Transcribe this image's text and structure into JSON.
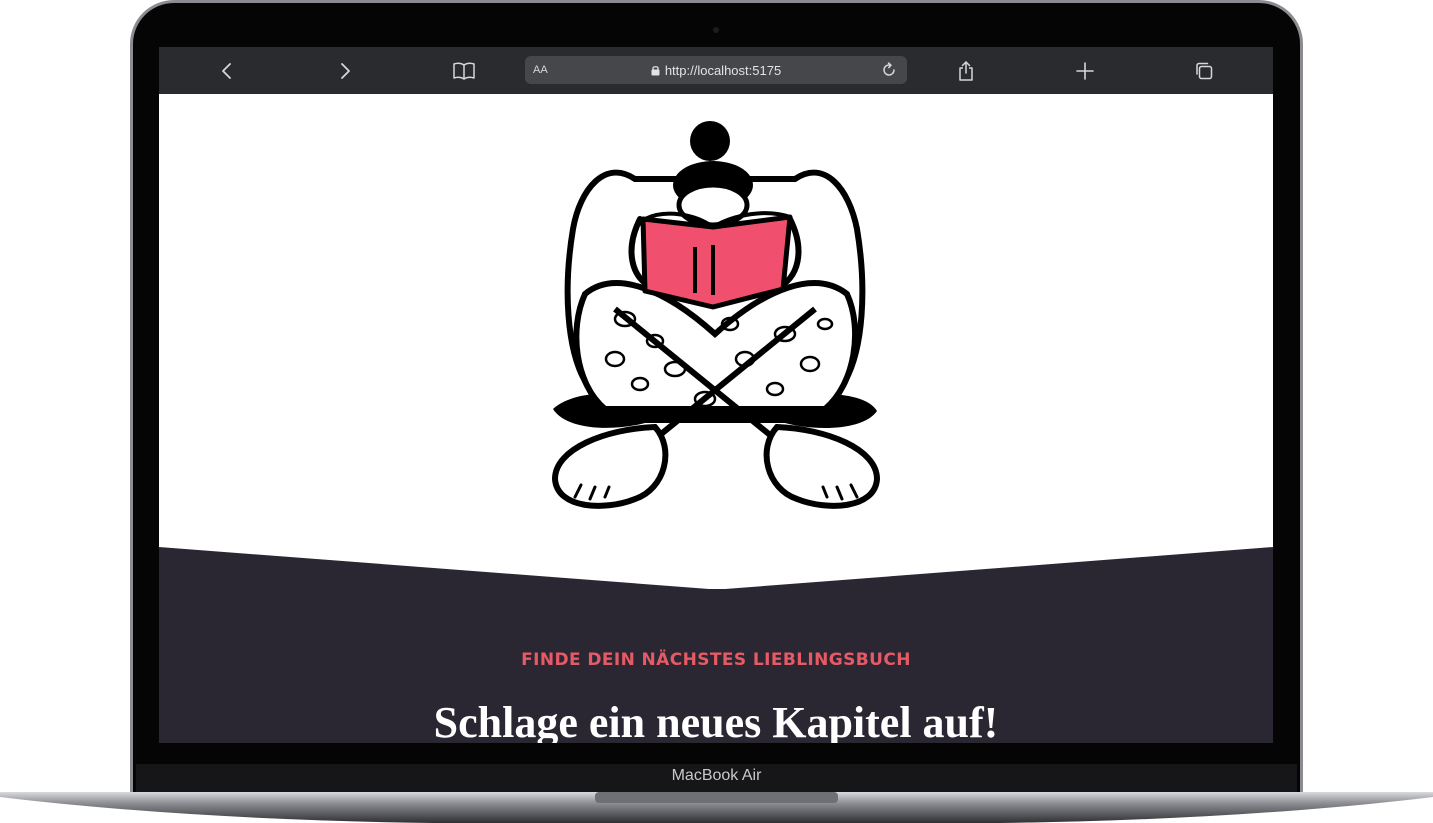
{
  "device": {
    "model_label": "MacBook Air"
  },
  "browser": {
    "aa_label": "AA",
    "url": "http://localhost:5175",
    "icons": {
      "back": "chevron-left-icon",
      "forward": "chevron-right-icon",
      "bookmarks": "book-icon",
      "lock": "lock-icon",
      "reload": "reload-icon",
      "share": "share-icon",
      "new_tab": "plus-icon",
      "tabs": "tabs-icon"
    }
  },
  "page": {
    "eyebrow": "FINDE DEIN NÄCHSTES LIEBLINGSBUCH",
    "headline": "Schlage ein neues Kapitel auf!",
    "illustration": "person-reading-book-illustration",
    "colors": {
      "accent": "#e65a66",
      "book": "#f0506e",
      "dark_section": "#2a2733",
      "toolbar": "#2a2b2e"
    }
  }
}
